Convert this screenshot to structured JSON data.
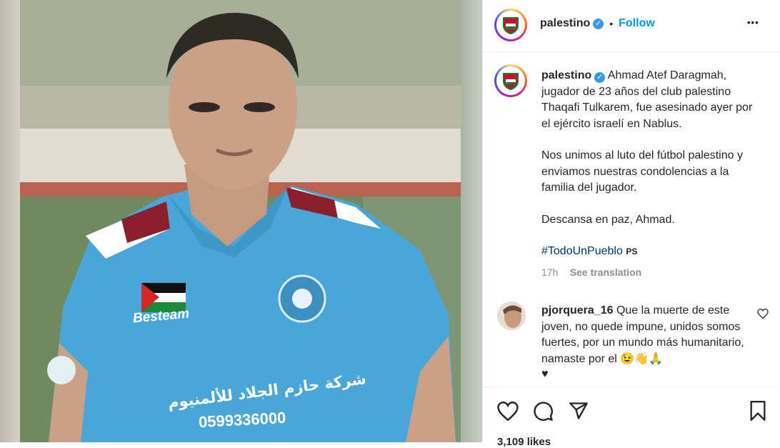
{
  "post": {
    "username": "palestino",
    "follow_label": "Follow",
    "dot": "•",
    "more_label": "•••",
    "caption_paragraphs": [
      "Ahmad Atef Daragmah, jugador de 23 años del club palestino Thaqafi Tulkarem, fue asesinado ayer por el ejército israelí en Nablus.",
      "Nos unimos al luto del fútbol palestino y enviamos nuestras condolencias a la familia del jugador.",
      "Descansa en paz, Ahmad."
    ],
    "hashtag": "#TodoUnPueblo",
    "hashtag_suffix": "PS",
    "time": "17h",
    "see_translation": "See translation",
    "likes_partial": "3,109 likes"
  },
  "comment": {
    "username": "pjorquera_16",
    "text": "Que la muerte de este joven, no quede impune, unidos somos fuertes, por un mundo más humanitario, namaste por el 😉👋🙏",
    "heart": "♥"
  },
  "photo": {
    "jersey_brand": "Besteam",
    "jersey_arabic": "شركة حازم الجلاد للألمنيوم",
    "jersey_phone": "0599336000"
  },
  "colors": {
    "accent": "#0095f6",
    "jersey": "#4aa6d8",
    "jersey_trim": "#8b1f2b"
  },
  "icons": [
    "heart-icon",
    "comment-icon",
    "share-icon",
    "bookmark-icon",
    "more-icon",
    "verified-icon"
  ]
}
